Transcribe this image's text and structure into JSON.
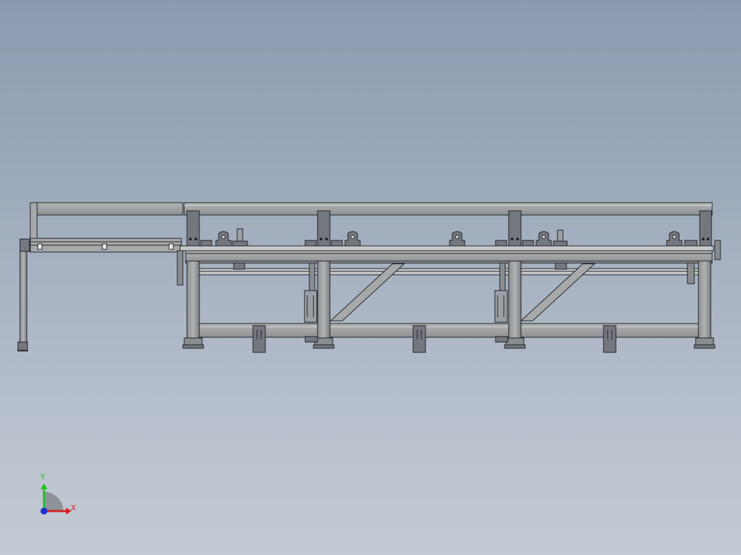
{
  "triad": {
    "x_label": "X",
    "y_label": "Y",
    "x_color": "#d42020",
    "y_color": "#20c020",
    "z_color": "#1f2fd0"
  },
  "colors": {
    "background_top": "#8a9bb0",
    "background_bottom": "#c5cbd5",
    "frame_fill": "#a6a8a9",
    "frame_dark": "#505458",
    "frame_line": "#1e2226",
    "bracket_fill": "#74787e",
    "cylinder_fill": "#9aa0a6"
  }
}
